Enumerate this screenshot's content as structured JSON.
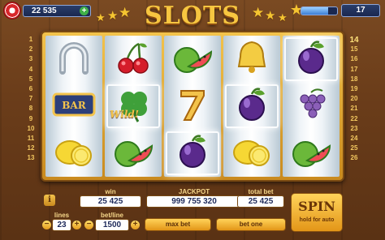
{
  "header": {
    "coins": "22 535",
    "coins_add": "+",
    "level_star": "★",
    "level": "17",
    "xp_progress": 0.75,
    "title": "SLOTS",
    "star_glyph": "★"
  },
  "reels": [
    [
      {
        "symbol": "horseshoe-icon"
      },
      {
        "symbol": "bar-icon",
        "text": "BAR"
      },
      {
        "symbol": "lemon-icon"
      }
    ],
    [
      {
        "symbol": "cherry-icon"
      },
      {
        "symbol": "clover-wild-icon",
        "text": "Wild!",
        "highlighted": true
      },
      {
        "symbol": "watermelon-icon"
      }
    ],
    [
      {
        "symbol": "watermelon-icon"
      },
      {
        "symbol": "seven-icon",
        "text": "7"
      },
      {
        "symbol": "plum-icon",
        "highlighted": true
      }
    ],
    [
      {
        "symbol": "bell-icon"
      },
      {
        "symbol": "plum-icon",
        "highlighted": true
      },
      {
        "symbol": "lemon-icon"
      }
    ],
    [
      {
        "symbol": "plum-icon",
        "highlighted": true
      },
      {
        "symbol": "grapes-icon"
      },
      {
        "symbol": "watermelon-icon"
      }
    ]
  ],
  "line_numbers_left": [
    "1",
    "2",
    "3",
    "4",
    "5",
    "6",
    "7",
    "8",
    "9",
    "10",
    "11",
    "12",
    "13"
  ],
  "line_numbers_right": [
    "14",
    "15",
    "16",
    "17",
    "18",
    "19",
    "20",
    "21",
    "22",
    "23",
    "24",
    "25",
    "26"
  ],
  "bottom": {
    "info": "i",
    "win_label": "win",
    "win_value": "25 425",
    "jackpot_label": "JACKPOT",
    "jackpot_value": "999 755 320",
    "total_bet_label": "total bet",
    "total_bet_value": "25 425",
    "lines_label": "lines",
    "lines_value": "23",
    "bet_line_label": "bet/line",
    "bet_line_value": "1500",
    "minus": "−",
    "plus": "+",
    "max_bet": "max bet",
    "bet_one": "bet one",
    "spin": "SPIN",
    "spin_sub": "hold for auto"
  },
  "colors": {
    "gold": "#f3c34b",
    "wood": "#6b3d1a",
    "navy": "#1e2a5a"
  }
}
